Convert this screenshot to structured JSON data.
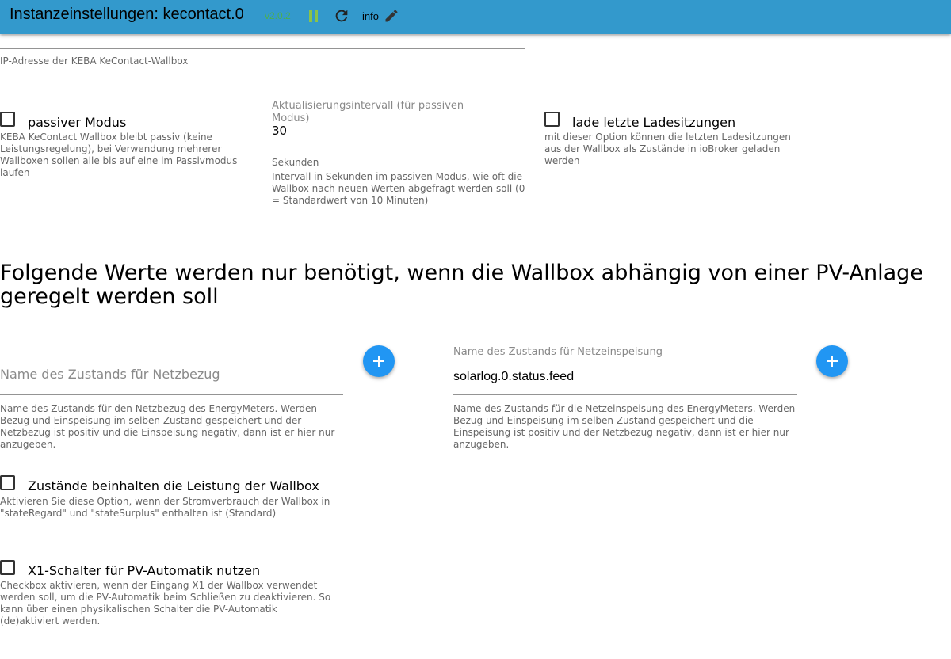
{
  "header": {
    "title": "Instanzeinstellungen: kecontact.0",
    "version": "v2.0.2",
    "info_label": "info",
    "icons": [
      "pause-icon",
      "reload-icon",
      "edit-icon"
    ],
    "colors": {
      "bar": "#3399cc",
      "version": "#4caf50",
      "pause": "#8bc34a"
    }
  },
  "ip_field": {
    "help": "IP-Adresse der KEBA KeContact-Wallbox"
  },
  "passive_mode": {
    "label": "passiver Modus",
    "checked": false,
    "help": "KEBA KeContact Wallbox bleibt passiv (keine Leistungsregelung), bei Verwendung mehrerer Wallboxen sollen alle bis auf eine im Passivmodus laufen"
  },
  "interval_field": {
    "label": "Aktualisierungsintervall (für passiven Modus)",
    "value": "30",
    "unit": "Sekunden",
    "help": "Intervall in Sekunden im passiven Modus, wie oft die Wallbox nach neuen Werten abgefragt werden soll (0 = Standardwert von 10 Minuten)"
  },
  "load_sessions": {
    "label": "lade letzte Ladesitzungen",
    "checked": false,
    "help": "mit dieser Option können die letzten Ladesitzungen aus der Wallbox als Zustände in ioBroker geladen werden"
  },
  "pv_section": {
    "heading": "Folgende Werte werden nur benötigt, wenn die Wallbox abhängig von einer PV-Anlage geregelt werden soll"
  },
  "grid_consumption": {
    "placeholder": "Name des Zustands für Netzbezug",
    "help": "Name des Zustands für den Netzbezug des EnergyMeters. Werden Bezug und Einspeisung im selben Zustand gespeichert und der Netzbezug ist positiv und die Einspeisung negativ, dann ist er hier nur anzugeben."
  },
  "grid_feed": {
    "label": "Name des Zustands für Netzeinspeisung",
    "value": "solarlog.0.status.feed",
    "help": "Name des Zustands für die Netzeinspeisung des EnergyMeters. Werden Bezug und Einspeisung im selben Zustand gespeichert und die Einspeisung ist positiv und der Netzbezug negativ, dann ist er hier nur anzugeben."
  },
  "wallbox_power": {
    "label": "Zustände beinhalten die Leistung der Wallbox",
    "checked": false,
    "help": "Aktivieren Sie diese Option, wenn der Stromverbrauch der Wallbox in \"stateRegard\" und \"stateSurplus\" enthalten ist (Standard)"
  },
  "x1_switch": {
    "label": "X1-Schalter für PV-Automatik nutzen",
    "checked": false,
    "help": "Checkbox aktivieren, wenn der Eingang X1 der Wallbox verwendet werden soll, um die PV-Automatik beim Schließen zu deaktivieren. So kann über einen physikalischen Schalter die PV-Automatik (de)aktiviert werden."
  }
}
